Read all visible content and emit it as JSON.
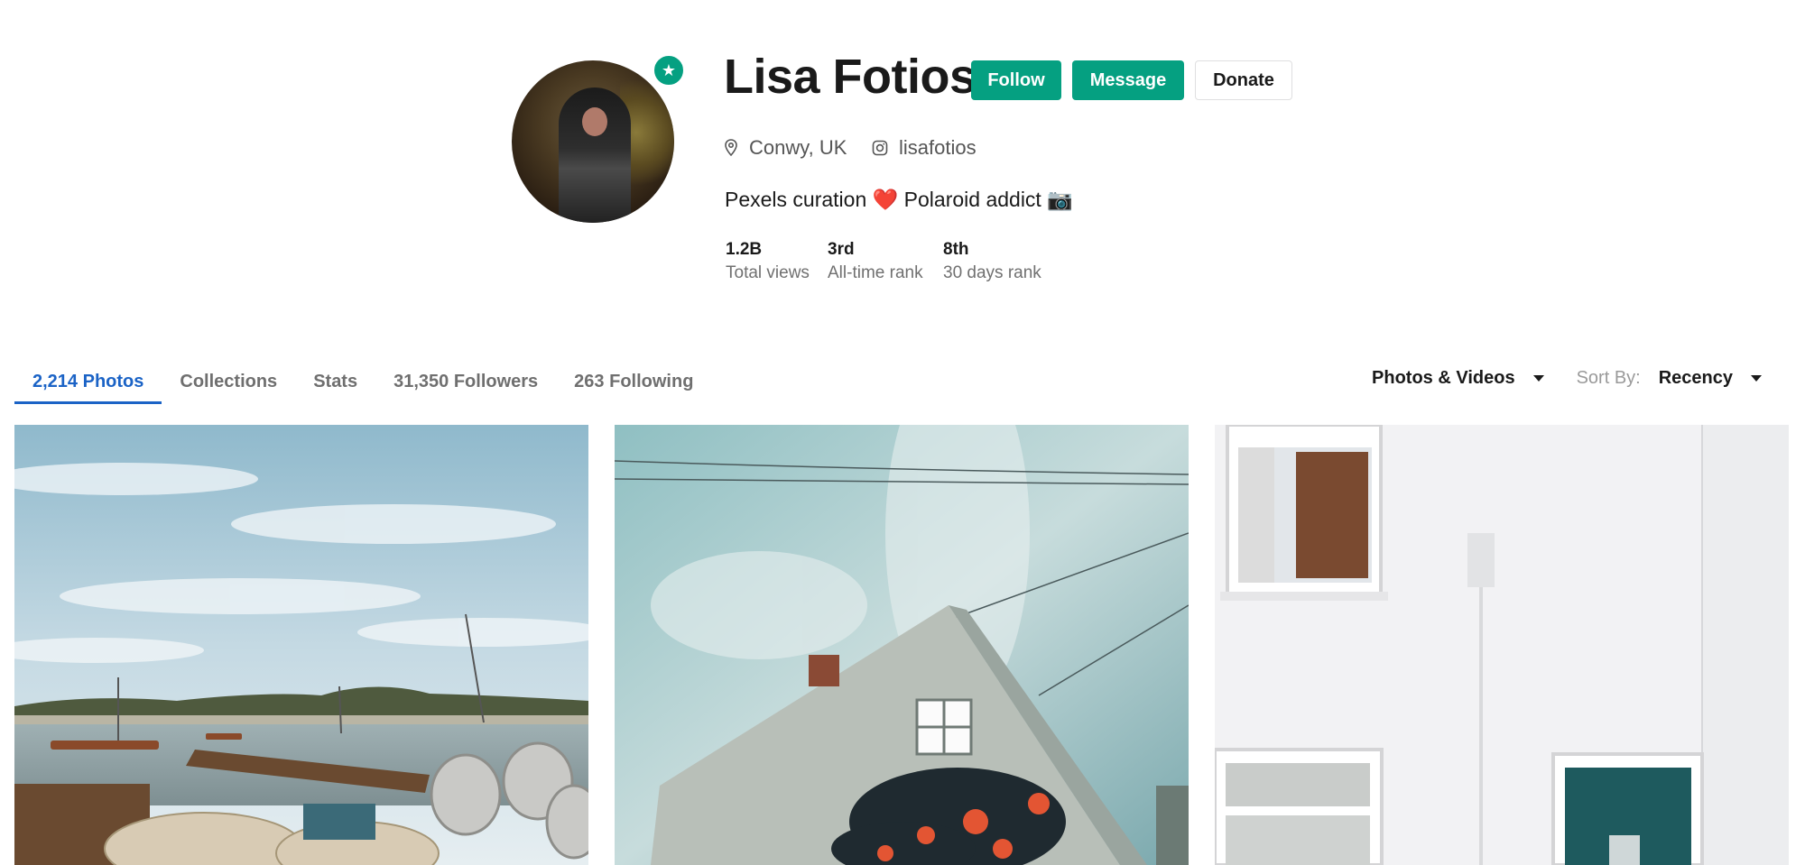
{
  "profile": {
    "name": "Lisa Fotios",
    "location": "Conwy, UK",
    "instagram": "lisafotios",
    "bio": "Pexels curation ❤️ Polaroid addict 📷",
    "badge_icon": "star-icon"
  },
  "actions": {
    "follow_label": "Follow",
    "message_label": "Message",
    "donate_label": "Donate"
  },
  "stats": [
    {
      "value": "1.2B",
      "label": "Total views"
    },
    {
      "value": "3rd",
      "label": "All-time rank"
    },
    {
      "value": "8th",
      "label": "30 days rank"
    }
  ],
  "tabs": [
    {
      "label": "2,214 Photos",
      "active": true
    },
    {
      "label": "Collections",
      "active": false
    },
    {
      "label": "Stats",
      "active": false
    },
    {
      "label": "31,350 Followers",
      "active": false
    },
    {
      "label": "263 Following",
      "active": false
    }
  ],
  "filters": {
    "media_type": "Photos & Videos",
    "sort_label": "Sort By:",
    "sort_value": "Recency"
  },
  "colors": {
    "brand_green": "#05a081",
    "active_tab_blue": "#1b63c6"
  }
}
